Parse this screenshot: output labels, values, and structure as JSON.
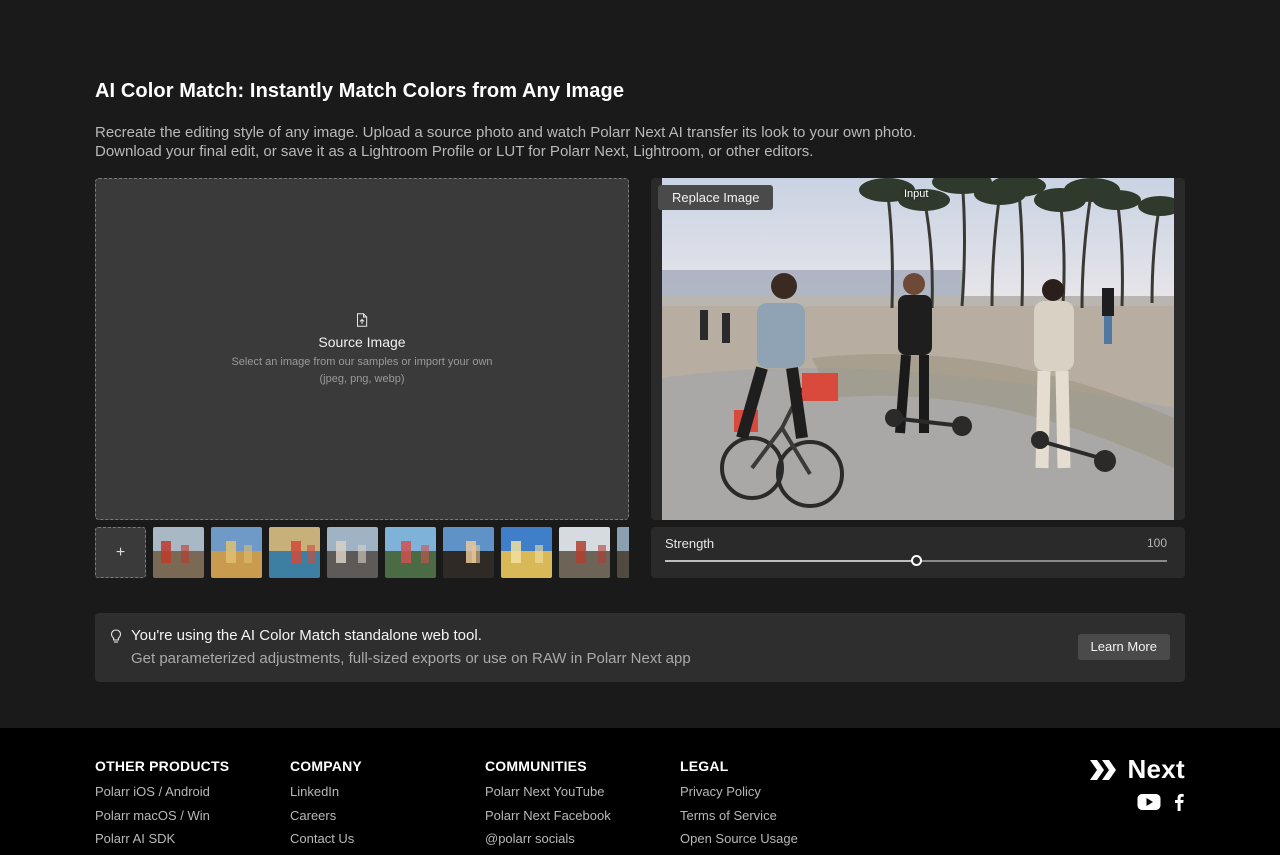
{
  "page": {
    "title": "AI Color Match: Instantly Match Colors from Any Image",
    "description_lines": [
      "Recreate the editing style of any image. Upload a source photo and watch Polarr Next AI transfer its look to your own photo.",
      "Download your final edit, or save it as a Lightroom Profile or LUT for Polarr Next, Lightroom, or other editors."
    ]
  },
  "source": {
    "icon": "file-upload-icon",
    "title": "Source Image",
    "subtitle_line1": "Select an image from our samples or import your own",
    "subtitle_line2": "(jpeg, png, webp)"
  },
  "samples": {
    "add_label": "+",
    "thumbnails": [
      {
        "name": "sample-1",
        "sky": "#a8b8c4",
        "ground": "#7a6a55",
        "accent": "#c0392b"
      },
      {
        "name": "sample-2",
        "sky": "#6f9ac7",
        "ground": "#c89b4f",
        "accent": "#e0c070"
      },
      {
        "name": "sample-3",
        "sky": "#c8b07a",
        "ground": "#3d7fa3",
        "accent": "#d04a3a"
      },
      {
        "name": "sample-4",
        "sky": "#9fb3c5",
        "ground": "#5d5a57",
        "accent": "#d8d0c4"
      },
      {
        "name": "sample-5",
        "sky": "#7fb2d8",
        "ground": "#4b6b45",
        "accent": "#d05050"
      },
      {
        "name": "sample-6",
        "sky": "#5f93c8",
        "ground": "#2f2a26",
        "accent": "#e8c79a"
      },
      {
        "name": "sample-7",
        "sky": "#3f7ec9",
        "ground": "#d9b857",
        "accent": "#f0e0a0"
      },
      {
        "name": "sample-8",
        "sky": "#d5dbe0",
        "ground": "#6e6357",
        "accent": "#b04030"
      },
      {
        "name": "sample-9",
        "sky": "#8aa0b0",
        "ground": "#504a40",
        "accent": "#a0a0a0"
      }
    ]
  },
  "input": {
    "replace_label": "Replace Image",
    "label": "Input"
  },
  "strength": {
    "label": "Strength",
    "value": "100",
    "fraction": 0.5
  },
  "banner": {
    "icon": "lightbulb-icon",
    "title": "You're using the AI Color Match standalone web tool.",
    "subtitle": "Get parameterized adjustments, full-sized exports or use on RAW in Polarr Next app",
    "button_label": "Learn More"
  },
  "footer": {
    "columns": [
      {
        "heading": "OTHER PRODUCTS",
        "links": [
          "Polarr iOS / Android",
          "Polarr macOS / Win",
          "Polarr AI SDK"
        ]
      },
      {
        "heading": "COMPANY",
        "links": [
          "LinkedIn",
          "Careers",
          "Contact Us"
        ]
      },
      {
        "heading": "COMMUNITIES",
        "links": [
          "Polarr Next YouTube",
          "Polarr Next Facebook",
          "@polarr socials"
        ]
      },
      {
        "heading": "LEGAL",
        "links": [
          "Privacy Policy",
          "Terms of Service",
          "Open Source Usage"
        ]
      }
    ],
    "brand": {
      "name": "Next",
      "logo_icon": "polarr-next-logo-icon",
      "socials": [
        "youtube-icon",
        "facebook-icon"
      ]
    }
  },
  "colors": {
    "background": "#1a1a1a",
    "panel": "#3a3a3a",
    "footer": "#000000",
    "button": "#4a4a4a"
  }
}
